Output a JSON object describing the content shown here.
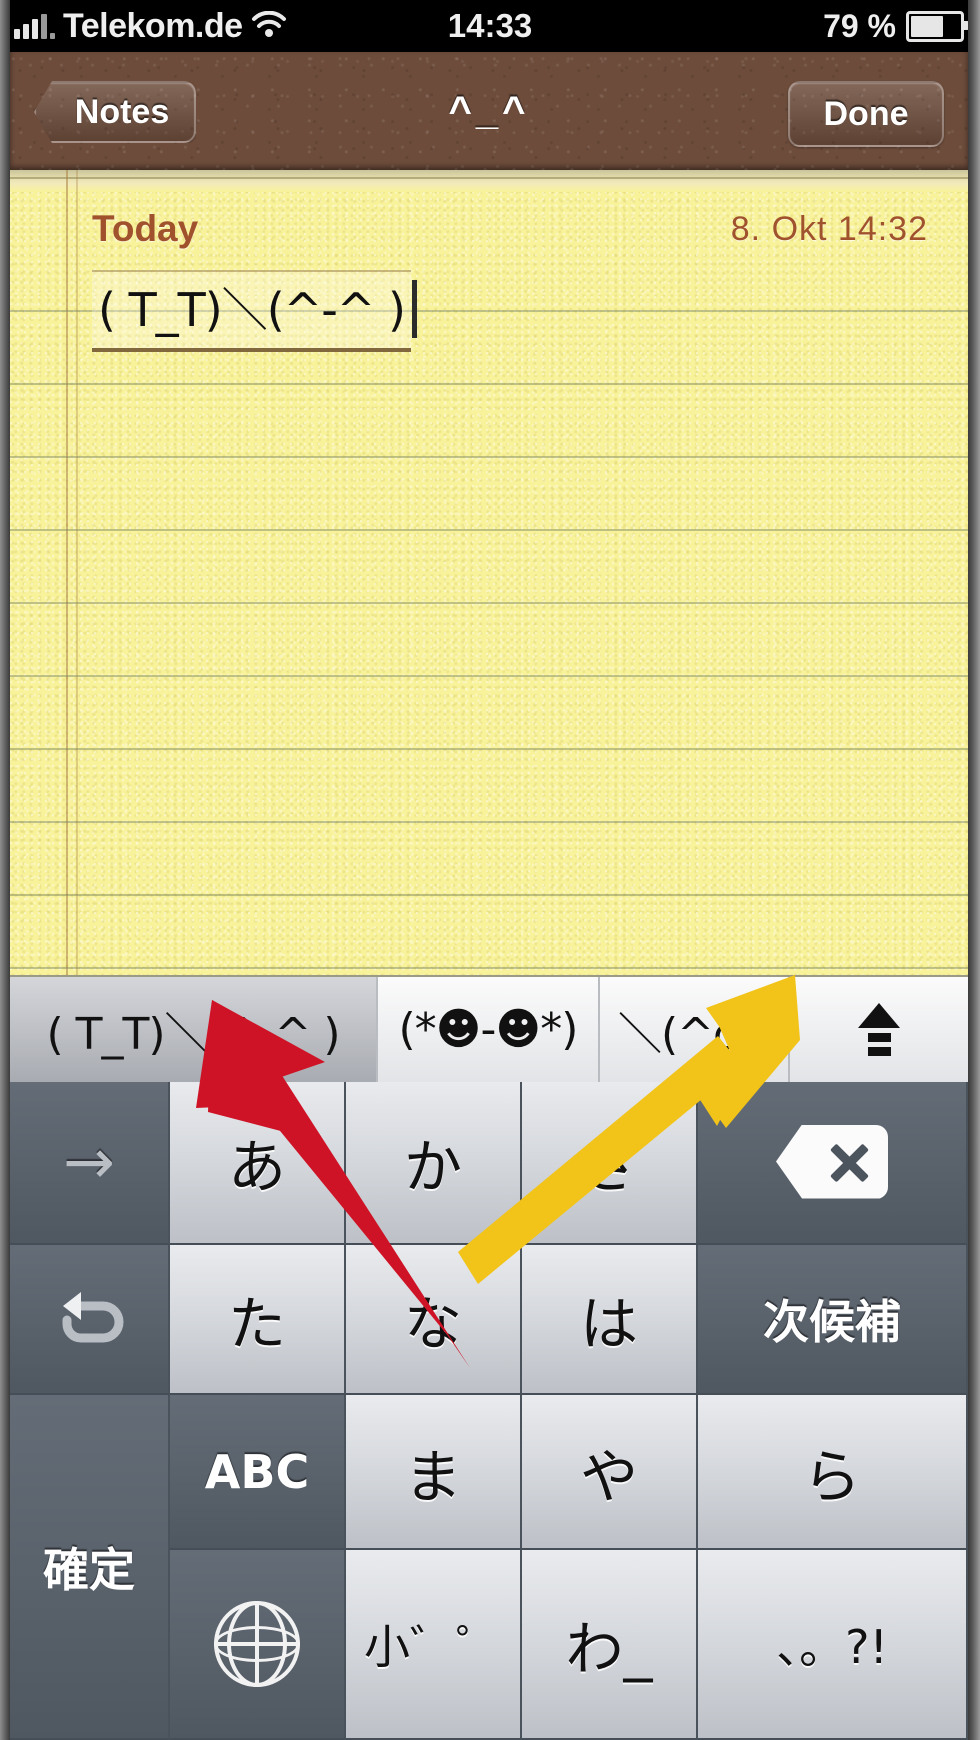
{
  "status_bar": {
    "signal_icon": "signal-bars-icon",
    "carrier": "Telekom.de",
    "wifi_icon": "wifi-icon",
    "time": "14:33",
    "battery_percent": "79 %",
    "battery_icon": "battery-icon"
  },
  "nav_bar": {
    "back_label": "Notes",
    "title": "^_^",
    "done_label": "Done"
  },
  "note": {
    "day_label": "Today",
    "date": "8. Okt   14:32",
    "text": "( T_T)＼(^-^ )"
  },
  "candidate_bar": {
    "candidates": [
      {
        "text": "( T_T)＼(^-^ )",
        "selected": true
      },
      {
        "text": "(*☻-☻*)",
        "selected": false
      },
      {
        "text": "＼(^o",
        "selected": false
      }
    ],
    "expand_icon": "expand-candidates-icon"
  },
  "keyboard": {
    "rows": [
      [
        {
          "label": "→",
          "name": "cursor-right-key",
          "type": "dark-icon"
        },
        {
          "label": "あ",
          "name": "key-a-row",
          "type": "light"
        },
        {
          "label": "か",
          "name": "key-ka-row",
          "type": "light"
        },
        {
          "label": "さ",
          "name": "key-sa-row",
          "type": "light"
        },
        {
          "label": "⌫",
          "name": "delete-key",
          "type": "dark-icon"
        }
      ],
      [
        {
          "label": "↺",
          "name": "undo-key",
          "type": "dark-icon"
        },
        {
          "label": "た",
          "name": "key-ta-row",
          "type": "light"
        },
        {
          "label": "な",
          "name": "key-na-row",
          "type": "light"
        },
        {
          "label": "は",
          "name": "key-ha-row",
          "type": "light"
        },
        {
          "label": "次候補",
          "name": "next-candidate-key",
          "type": "dark"
        }
      ],
      [
        {
          "label": "ABC",
          "name": "abc-key",
          "type": "dark"
        },
        {
          "label": "ま",
          "name": "key-ma-row",
          "type": "light"
        },
        {
          "label": "や",
          "name": "key-ya-row",
          "type": "light"
        },
        {
          "label": "ら",
          "name": "key-ra-row",
          "type": "light"
        },
        {
          "label": "確定",
          "name": "confirm-key",
          "type": "dark"
        }
      ],
      [
        {
          "label": "globe",
          "name": "globe-key",
          "type": "dark-icon"
        },
        {
          "label": "小゛゜",
          "name": "key-modifier",
          "type": "light"
        },
        {
          "label": "わ_",
          "name": "key-wa-row",
          "type": "light"
        },
        {
          "label": "、。?!",
          "name": "key-punctuation",
          "type": "light"
        }
      ]
    ]
  },
  "annotations": [
    {
      "name": "red-arrow",
      "color": "#cf1326",
      "points_to": "key-a-row"
    },
    {
      "name": "yellow-arrow",
      "color": "#f2c318",
      "points_to": "expand-candidates-icon"
    }
  ],
  "colors": {
    "leather": "#6d4c3b",
    "paper": "#f8f29a",
    "note_accent": "#a0522d",
    "key_dark": "#5e6670",
    "key_light": "#dcdfe4"
  }
}
